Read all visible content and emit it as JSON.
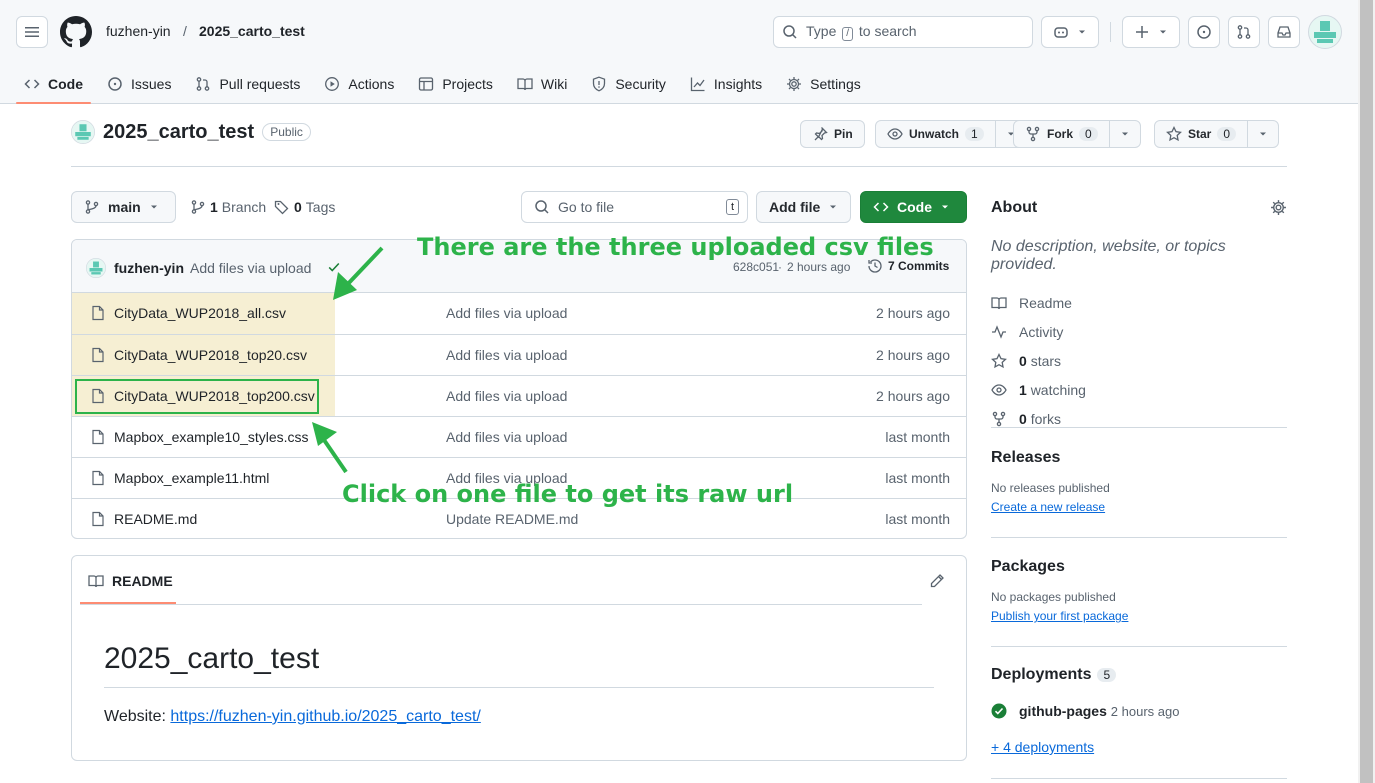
{
  "header": {
    "owner": "fuzhen-yin",
    "separator": "/",
    "repo": "2025_carto_test",
    "search_prefix": "Type",
    "search_key": "/",
    "search_suffix": "to search"
  },
  "tabs": [
    {
      "label": "Code",
      "icon": "code-icon"
    },
    {
      "label": "Issues",
      "icon": "issue-icon"
    },
    {
      "label": "Pull requests",
      "icon": "pull-request-icon"
    },
    {
      "label": "Actions",
      "icon": "play-icon"
    },
    {
      "label": "Projects",
      "icon": "table-icon"
    },
    {
      "label": "Wiki",
      "icon": "book-icon"
    },
    {
      "label": "Security",
      "icon": "shield-icon"
    },
    {
      "label": "Insights",
      "icon": "graph-icon"
    },
    {
      "label": "Settings",
      "icon": "gear-icon"
    }
  ],
  "repo_head": {
    "name": "2025_carto_test",
    "visibility": "Public",
    "pin": "Pin",
    "unwatch": "Unwatch",
    "unwatch_count": "1",
    "fork": "Fork",
    "fork_count": "0",
    "star": "Star",
    "star_count": "0"
  },
  "toolbar": {
    "branch": "main",
    "branches_count": "1",
    "branches_label": "Branch",
    "tags_count": "0",
    "tags_label": "Tags",
    "goto_placeholder": "Go to file",
    "goto_key": "t",
    "add_file": "Add file",
    "code": "Code"
  },
  "latest_commit": {
    "author": "fuzhen-yin",
    "message": "Add files via upload",
    "hash": "628c051",
    "time": "2 hours ago",
    "commits_label": "7 Commits"
  },
  "files": [
    {
      "name": "CityData_WUP2018_all.csv",
      "message": "Add files via upload",
      "date": "2 hours ago"
    },
    {
      "name": "CityData_WUP2018_top20.csv",
      "message": "Add files via upload",
      "date": "2 hours ago"
    },
    {
      "name": "CityData_WUP2018_top200.csv",
      "message": "Add files via upload",
      "date": "2 hours ago"
    },
    {
      "name": "Mapbox_example10_styles.css",
      "message": "Add files via upload",
      "date": "last month"
    },
    {
      "name": "Mapbox_example11.html",
      "message": "Add files via upload",
      "date": "last month"
    },
    {
      "name": "README.md",
      "message": "Update README.md",
      "date": "last month"
    }
  ],
  "readme": {
    "tab": "README",
    "title": "2025_carto_test",
    "website_label": "Website:",
    "website_url": "https://fuzhen-yin.github.io/2025_carto_test/"
  },
  "about": {
    "title": "About",
    "description": "No description, website, or topics provided.",
    "readme": "Readme",
    "activity": "Activity",
    "stars_count": "0",
    "stars_label": "stars",
    "watching_count": "1",
    "watching_label": "watching",
    "forks_count": "0",
    "forks_label": "forks"
  },
  "releases": {
    "title": "Releases",
    "text": "No releases published",
    "link": "Create a new release"
  },
  "packages": {
    "title": "Packages",
    "text": "No packages published",
    "link": "Publish your first package"
  },
  "deployments": {
    "title": "Deployments",
    "count": "5",
    "env": "github-pages",
    "time": "2 hours ago",
    "more": "+ 4 deployments"
  },
  "annotations": {
    "top": "There are the three uploaded csv files",
    "bottom": "Click on one file to get its raw url",
    "color": "#2db34a"
  }
}
